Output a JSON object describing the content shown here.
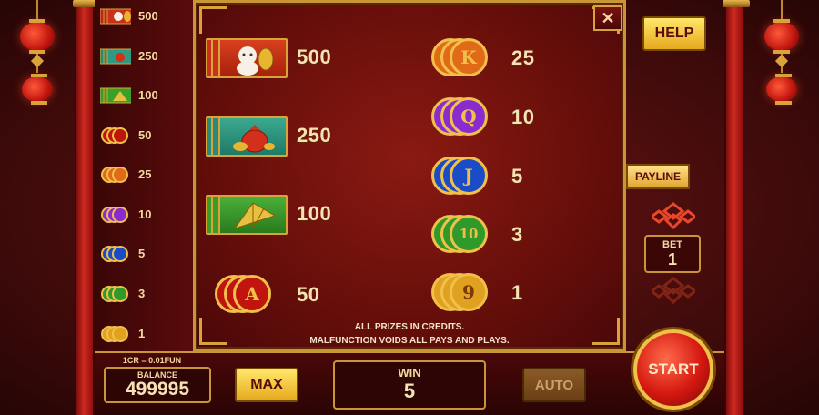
{
  "paytable_mini": [
    {
      "icon": "lucky-cat-icon",
      "value": "500"
    },
    {
      "icon": "money-bag-icon",
      "value": "250"
    },
    {
      "icon": "fan-icon",
      "value": "100"
    },
    {
      "icon": "coin-a-icon",
      "value": "50"
    },
    {
      "icon": "coin-k-icon",
      "value": "25"
    },
    {
      "icon": "coin-q-icon",
      "value": "10"
    },
    {
      "icon": "coin-j-icon",
      "value": "5"
    },
    {
      "icon": "coin-10-icon",
      "value": "3"
    },
    {
      "icon": "coin-9-icon",
      "value": "1"
    }
  ],
  "paytable_main": {
    "cat": "500",
    "bag": "250",
    "fan": "100",
    "ace": "50",
    "king": "25",
    "queen": "10",
    "jack": "5",
    "ten": "3",
    "nine": "1"
  },
  "disclaimer": {
    "line1": "ALL PRIZES IN CREDITS.",
    "line2": "MALFUNCTION VOIDS ALL PAYS AND PLAYS."
  },
  "controls": {
    "close": "✕",
    "help": "HELP",
    "payline": "PAYLINE",
    "bet_label": "BET",
    "bet_value": "1",
    "cr_rate": "1CR = 0.01FUN",
    "balance_label": "BALANCE",
    "balance_value": "499995",
    "max": "MAX",
    "win_label": "WIN",
    "win_value": "5",
    "auto": "AUTO",
    "start": "START"
  },
  "colors": {
    "gold": "#d9a33b",
    "deep_red": "#4a0808",
    "coin_red": "#c0140e",
    "coin_purple": "#8a2bd0",
    "coin_blue": "#1a4cc8",
    "coin_green": "#2f9a2a",
    "coin_gold": "#e0a020"
  }
}
